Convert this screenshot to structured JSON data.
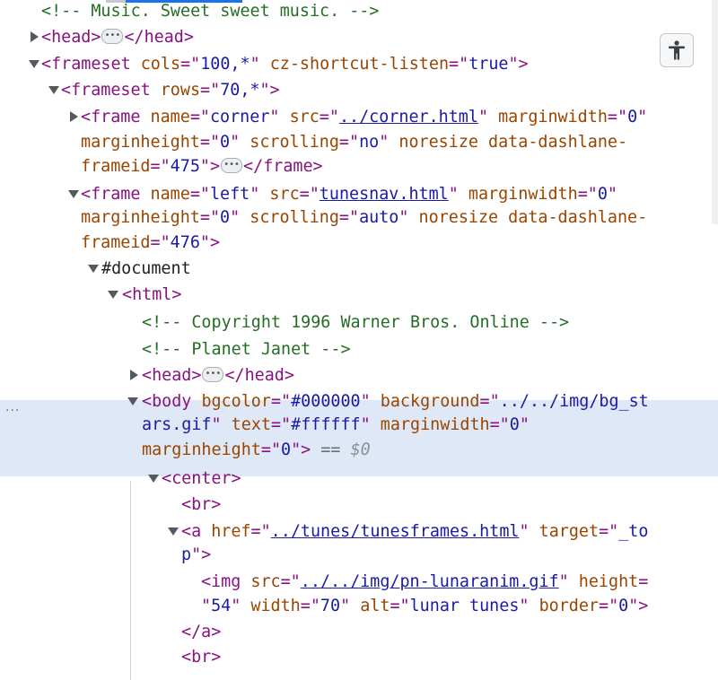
{
  "topbar": {
    "scroll_hint": ""
  },
  "lines": [
    {
      "id": "comment-music",
      "tokens": [
        {
          "k": "c",
          "t": "<!-- Music. Sweet sweet music. -->"
        }
      ]
    },
    {
      "id": "head-collapsed-1",
      "tokens": [
        {
          "k": "t",
          "t": "<head>"
        },
        {
          "k": "ell"
        },
        {
          "k": "t",
          "t": "</head>"
        }
      ]
    },
    {
      "id": "frameset-cols",
      "tokens": [
        {
          "k": "t",
          "t": "<frameset "
        },
        {
          "k": "a",
          "t": "cols"
        },
        {
          "k": "t",
          "t": "=\""
        },
        {
          "k": "v",
          "t": "100,*"
        },
        {
          "k": "t",
          "t": "\" "
        },
        {
          "k": "a",
          "t": "cz-shortcut-listen"
        },
        {
          "k": "t",
          "t": "=\""
        },
        {
          "k": "v",
          "t": "true"
        },
        {
          "k": "t",
          "t": "\">"
        }
      ]
    },
    {
      "id": "frameset-rows",
      "tokens": [
        {
          "k": "t",
          "t": "<frameset "
        },
        {
          "k": "a",
          "t": "rows"
        },
        {
          "k": "t",
          "t": "=\""
        },
        {
          "k": "v",
          "t": "70,*"
        },
        {
          "k": "t",
          "t": "\">"
        }
      ]
    },
    {
      "id": "frame-corner-1",
      "tokens": [
        {
          "k": "t",
          "t": "<frame "
        },
        {
          "k": "a",
          "t": "name"
        },
        {
          "k": "t",
          "t": "=\""
        },
        {
          "k": "v",
          "t": "corner"
        },
        {
          "k": "t",
          "t": "\" "
        },
        {
          "k": "a",
          "t": "src"
        },
        {
          "k": "t",
          "t": "=\""
        },
        {
          "k": "l",
          "t": "../corner.html"
        },
        {
          "k": "t",
          "t": "\" "
        },
        {
          "k": "a",
          "t": "marginwidth"
        },
        {
          "k": "t",
          "t": "=\""
        },
        {
          "k": "v",
          "t": "0"
        },
        {
          "k": "t",
          "t": "\""
        }
      ]
    },
    {
      "id": "frame-corner-2",
      "tokens": [
        {
          "k": "a",
          "t": "marginheight"
        },
        {
          "k": "t",
          "t": "=\""
        },
        {
          "k": "v",
          "t": "0"
        },
        {
          "k": "t",
          "t": "\" "
        },
        {
          "k": "a",
          "t": "scrolling"
        },
        {
          "k": "t",
          "t": "=\""
        },
        {
          "k": "v",
          "t": "no"
        },
        {
          "k": "t",
          "t": "\" "
        },
        {
          "k": "a",
          "t": "noresize data-dashlane-"
        }
      ]
    },
    {
      "id": "frame-corner-3",
      "tokens": [
        {
          "k": "a",
          "t": "frameid"
        },
        {
          "k": "t",
          "t": "=\""
        },
        {
          "k": "v",
          "t": "475"
        },
        {
          "k": "t",
          "t": "\">"
        },
        {
          "k": "ell"
        },
        {
          "k": "t",
          "t": "</frame>"
        }
      ]
    },
    {
      "id": "frame-left-1",
      "tokens": [
        {
          "k": "t",
          "t": "<frame "
        },
        {
          "k": "a",
          "t": "name"
        },
        {
          "k": "t",
          "t": "=\""
        },
        {
          "k": "v",
          "t": "left"
        },
        {
          "k": "t",
          "t": "\" "
        },
        {
          "k": "a",
          "t": "src"
        },
        {
          "k": "t",
          "t": "=\""
        },
        {
          "k": "l",
          "t": "tunesnav.html"
        },
        {
          "k": "t",
          "t": "\" "
        },
        {
          "k": "a",
          "t": "marginwidth"
        },
        {
          "k": "t",
          "t": "=\""
        },
        {
          "k": "v",
          "t": "0"
        },
        {
          "k": "t",
          "t": "\""
        }
      ]
    },
    {
      "id": "frame-left-2",
      "tokens": [
        {
          "k": "a",
          "t": "marginheight"
        },
        {
          "k": "t",
          "t": "=\""
        },
        {
          "k": "v",
          "t": "0"
        },
        {
          "k": "t",
          "t": "\" "
        },
        {
          "k": "a",
          "t": "scrolling"
        },
        {
          "k": "t",
          "t": "=\""
        },
        {
          "k": "v",
          "t": "auto"
        },
        {
          "k": "t",
          "t": "\" "
        },
        {
          "k": "a",
          "t": "noresize data-dashlane-"
        }
      ]
    },
    {
      "id": "frame-left-3",
      "tokens": [
        {
          "k": "a",
          "t": "frameid"
        },
        {
          "k": "t",
          "t": "=\""
        },
        {
          "k": "v",
          "t": "476"
        },
        {
          "k": "t",
          "t": "\">"
        }
      ]
    },
    {
      "id": "document-node",
      "tokens": [
        {
          "k": "p",
          "t": "#document"
        }
      ]
    },
    {
      "id": "html-open",
      "tokens": [
        {
          "k": "t",
          "t": "<html>"
        }
      ]
    },
    {
      "id": "comment-copyright",
      "tokens": [
        {
          "k": "c",
          "t": "<!-- Copyright 1996 Warner Bros. Online -->"
        }
      ]
    },
    {
      "id": "comment-planet",
      "tokens": [
        {
          "k": "c",
          "t": "<!-- Planet Janet -->"
        }
      ]
    },
    {
      "id": "head-collapsed-2",
      "tokens": [
        {
          "k": "t",
          "t": "<head>"
        },
        {
          "k": "ell"
        },
        {
          "k": "t",
          "t": "</head>"
        }
      ]
    },
    {
      "id": "body-1",
      "tokens": [
        {
          "k": "t",
          "t": "<body "
        },
        {
          "k": "a",
          "t": "bgcolor"
        },
        {
          "k": "t",
          "t": "=\""
        },
        {
          "k": "v",
          "t": "#000000"
        },
        {
          "k": "t",
          "t": "\" "
        },
        {
          "k": "a",
          "t": "background"
        },
        {
          "k": "t",
          "t": "=\""
        },
        {
          "k": "v",
          "t": "../../img/bg_st"
        }
      ]
    },
    {
      "id": "body-2",
      "tokens": [
        {
          "k": "v",
          "t": "ars.gif"
        },
        {
          "k": "t",
          "t": "\" "
        },
        {
          "k": "a",
          "t": "text"
        },
        {
          "k": "t",
          "t": "=\""
        },
        {
          "k": "v",
          "t": "#ffffff"
        },
        {
          "k": "t",
          "t": "\" "
        },
        {
          "k": "a",
          "t": "marginwidth"
        },
        {
          "k": "t",
          "t": "=\""
        },
        {
          "k": "v",
          "t": "0"
        },
        {
          "k": "t",
          "t": "\""
        }
      ]
    },
    {
      "id": "body-3",
      "tokens": [
        {
          "k": "a",
          "t": "marginheight"
        },
        {
          "k": "t",
          "t": "=\""
        },
        {
          "k": "v",
          "t": "0"
        },
        {
          "k": "t",
          "t": "\">"
        },
        {
          "k": "eq",
          "t": " == "
        },
        {
          "k": "g",
          "t": "$0"
        }
      ]
    },
    {
      "id": "center-open",
      "tokens": [
        {
          "k": "t",
          "t": "<center>"
        }
      ]
    },
    {
      "id": "br-1",
      "tokens": [
        {
          "k": "t",
          "t": "<br>"
        }
      ]
    },
    {
      "id": "a-1",
      "tokens": [
        {
          "k": "t",
          "t": "<a "
        },
        {
          "k": "a",
          "t": "href"
        },
        {
          "k": "t",
          "t": "=\""
        },
        {
          "k": "l",
          "t": "../tunes/tunesframes.html"
        },
        {
          "k": "t",
          "t": "\" "
        },
        {
          "k": "a",
          "t": "target"
        },
        {
          "k": "t",
          "t": "=\""
        },
        {
          "k": "v",
          "t": "_to"
        }
      ]
    },
    {
      "id": "a-2",
      "tokens": [
        {
          "k": "v",
          "t": "p"
        },
        {
          "k": "t",
          "t": "\">"
        }
      ]
    },
    {
      "id": "img-1",
      "tokens": [
        {
          "k": "t",
          "t": "<img "
        },
        {
          "k": "a",
          "t": "src"
        },
        {
          "k": "t",
          "t": "=\""
        },
        {
          "k": "l",
          "t": "../../img/pn-lunaranim.gif"
        },
        {
          "k": "t",
          "t": "\" "
        },
        {
          "k": "a",
          "t": "height"
        },
        {
          "k": "t",
          "t": "="
        }
      ]
    },
    {
      "id": "img-2",
      "tokens": [
        {
          "k": "t",
          "t": "\""
        },
        {
          "k": "v",
          "t": "54"
        },
        {
          "k": "t",
          "t": "\" "
        },
        {
          "k": "a",
          "t": "width"
        },
        {
          "k": "t",
          "t": "=\""
        },
        {
          "k": "v",
          "t": "70"
        },
        {
          "k": "t",
          "t": "\" "
        },
        {
          "k": "a",
          "t": "alt"
        },
        {
          "k": "t",
          "t": "=\""
        },
        {
          "k": "v",
          "t": "lunar tunes"
        },
        {
          "k": "t",
          "t": "\" "
        },
        {
          "k": "a",
          "t": "border"
        },
        {
          "k": "t",
          "t": "=\""
        },
        {
          "k": "v",
          "t": "0"
        },
        {
          "k": "t",
          "t": "\">"
        }
      ]
    },
    {
      "id": "a-close",
      "tokens": [
        {
          "k": "t",
          "t": "</a>"
        }
      ]
    },
    {
      "id": "br-2",
      "tokens": [
        {
          "k": "t",
          "t": "<br>"
        }
      ]
    }
  ],
  "selected_row_gutter": "···",
  "toolbar": {
    "accessibility_icon": "accessibility-person-icon"
  },
  "colors": {
    "tag": "#881280",
    "attr": "#994500",
    "value": "#1a1aa6",
    "comment": "#236e25",
    "selection": "#dfe8f7"
  }
}
